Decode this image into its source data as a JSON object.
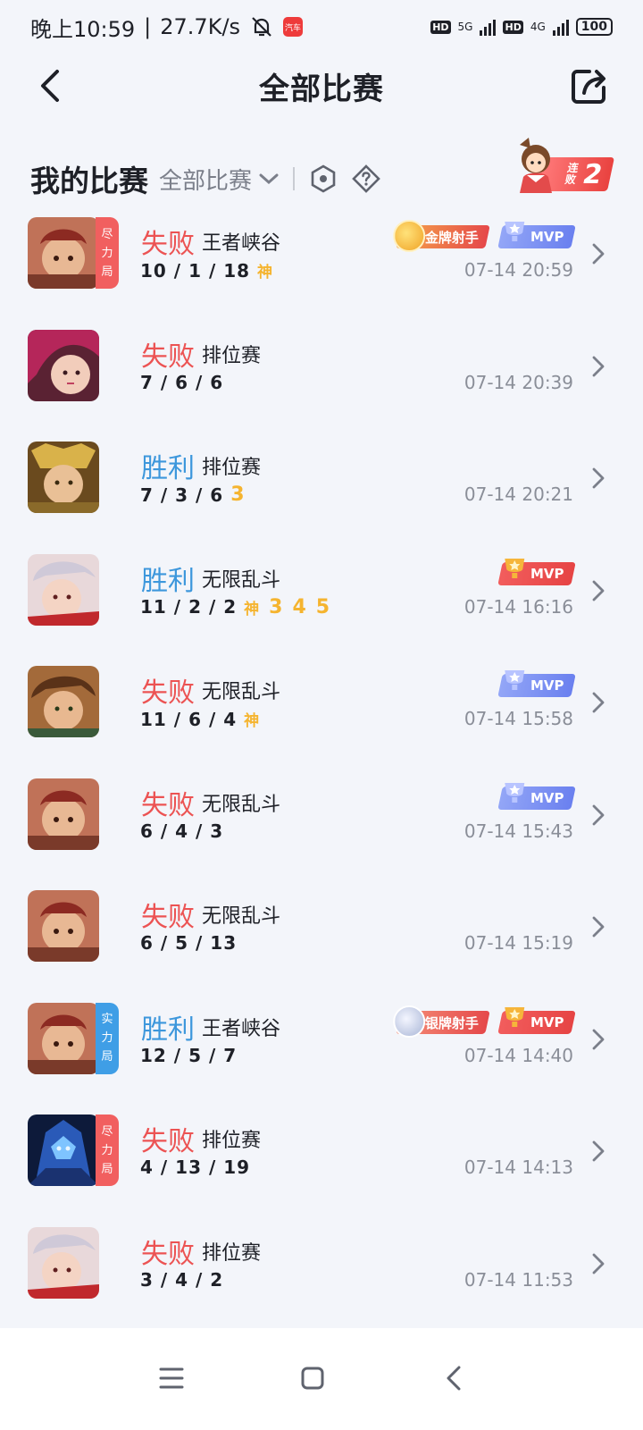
{
  "status_bar": {
    "time": "晚上10:59",
    "speed": "27.7K/s",
    "app_badge": "汽车",
    "hd_label": "HD",
    "net1": "5G",
    "net2": "4G",
    "battery": "100"
  },
  "header": {
    "title": "全部比赛",
    "back_icon": "back-arrow-icon",
    "share_icon": "share-icon"
  },
  "section": {
    "my_matches": "我的比赛",
    "filter": "全部比赛",
    "streak_label": "连败",
    "streak_count": "2"
  },
  "colors": {
    "lose": "#ec5353",
    "win": "#3d97dc",
    "mark": "#f5b42f"
  },
  "matches": [
    {
      "result": "失败",
      "mode": "王者峡谷",
      "kda": "10 / 1 / 18",
      "marks": [
        "神"
      ],
      "time": "07-14 20:59",
      "badge": [
        "尽",
        "力",
        "局"
      ],
      "awards": [
        "金牌射手",
        "MVP"
      ]
    },
    {
      "result": "失败",
      "mode": "排位赛",
      "kda": "7 / 6 / 6",
      "marks": [],
      "time": "07-14 20:39"
    },
    {
      "result": "胜利",
      "mode": "排位赛",
      "kda": "7 / 3 / 6",
      "marks": [
        "3"
      ],
      "time": "07-14 20:21"
    },
    {
      "result": "胜利",
      "mode": "无限乱斗",
      "kda": "11 / 2 / 2",
      "marks": [
        "神",
        "3",
        "4",
        "5"
      ],
      "time": "07-14 16:16",
      "awards": [
        "MVP"
      ]
    },
    {
      "result": "失败",
      "mode": "无限乱斗",
      "kda": "11 / 6 / 4",
      "marks": [
        "神"
      ],
      "time": "07-14 15:58",
      "awards": [
        "MVP"
      ]
    },
    {
      "result": "失败",
      "mode": "无限乱斗",
      "kda": "6 / 4 / 3",
      "marks": [],
      "time": "07-14 15:43",
      "awards": [
        "MVP"
      ]
    },
    {
      "result": "失败",
      "mode": "无限乱斗",
      "kda": "6 / 5 / 13",
      "marks": [],
      "time": "07-14 15:19"
    },
    {
      "result": "胜利",
      "mode": "王者峡谷",
      "kda": "12 / 5 / 7",
      "marks": [],
      "time": "07-14 14:40",
      "badge": [
        "实",
        "力",
        "局"
      ],
      "awards": [
        "银牌射手",
        "MVP"
      ]
    },
    {
      "result": "失败",
      "mode": "排位赛",
      "kda": "4 / 13 / 19",
      "marks": [],
      "time": "07-14 14:13",
      "badge": [
        "尽",
        "力",
        "局"
      ]
    },
    {
      "result": "失败",
      "mode": "排位赛",
      "kda": "3 / 4 / 2",
      "marks": [],
      "time": "07-14 11:53"
    }
  ],
  "nav": {
    "menu_icon": "menu-icon",
    "home_icon": "home-square-icon",
    "back_icon": "nav-back-icon"
  }
}
